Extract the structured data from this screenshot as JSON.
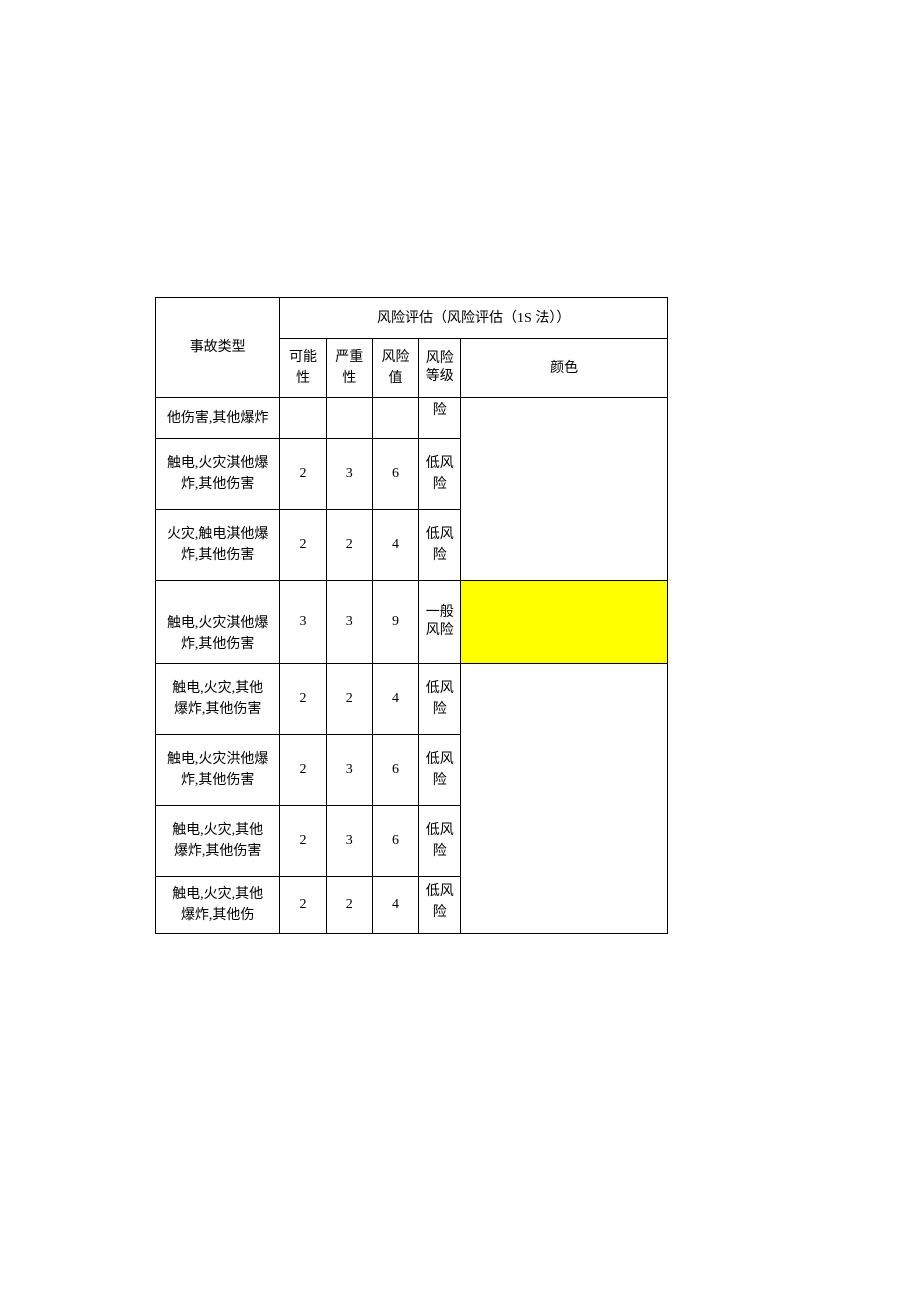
{
  "headers": {
    "accident_type": "事故类型",
    "risk_eval_group": "风险评估（风险评估（1S 法））",
    "likelihood": "可能性",
    "severity": "严重性",
    "risk_value": "风险值",
    "risk_level_l1": "风险",
    "risk_level_l2": "等级",
    "color": "颜色"
  },
  "chart_data": {
    "type": "table",
    "title": "风险评估（风险评估（1S 法））",
    "columns": [
      "事故类型",
      "可能性",
      "严重性",
      "风险值",
      "风险等级",
      "颜色"
    ],
    "color_groups": [
      {
        "rows": [
          0,
          1,
          2
        ],
        "color": ""
      },
      {
        "rows": [
          3
        ],
        "color": "#ffff00"
      },
      {
        "rows": [
          4,
          5,
          6,
          7
        ],
        "color": ""
      }
    ],
    "rows": [
      {
        "accident": "他伤害,其他爆炸",
        "likelihood": "",
        "severity": "",
        "value": "",
        "level": "险"
      },
      {
        "accident": "触电,火灾淇他爆炸,其他伤害",
        "likelihood": 2,
        "severity": 3,
        "value": 6,
        "level": "低风险"
      },
      {
        "accident": "火灾,触电淇他爆炸,其他伤害",
        "likelihood": 2,
        "severity": 2,
        "value": 4,
        "level": "低风险"
      },
      {
        "accident": "触电,火灾淇他爆炸,其他伤害",
        "likelihood": 3,
        "severity": 3,
        "value": 9,
        "level": "一般风险"
      },
      {
        "accident": "触电,火灾,其他爆炸,其他伤害",
        "likelihood": 2,
        "severity": 2,
        "value": 4,
        "level": "低风险"
      },
      {
        "accident": "触电,火灾洪他爆炸,其他伤害",
        "likelihood": 2,
        "severity": 3,
        "value": 6,
        "level": "低风险"
      },
      {
        "accident": "触电,火灾,其他爆炸,其他伤害",
        "likelihood": 2,
        "severity": 3,
        "value": 6,
        "level": "低风险"
      },
      {
        "accident": "触电,火灾,其他爆炸,其他伤",
        "likelihood": 2,
        "severity": 2,
        "value": 4,
        "level": "低风险"
      }
    ]
  },
  "rows": {
    "r0": {
      "acc_l1": "他伤害,其他爆炸",
      "acc_l2": "",
      "like": "",
      "sev": "",
      "val": "",
      "lvl": "险"
    },
    "r1": {
      "acc_l1": "触电,火灾淇他爆",
      "acc_l2": "炸,其他伤害",
      "like": "2",
      "sev": "3",
      "val": "6",
      "lvl": "低风险"
    },
    "r2": {
      "acc_l1": "火灾,触电淇他爆",
      "acc_l2": "炸,其他伤害",
      "like": "2",
      "sev": "2",
      "val": "4",
      "lvl": "低风险"
    },
    "r3": {
      "acc_l1": "触电,火灾淇他爆",
      "acc_l2": "炸,其他伤害",
      "like": "3",
      "sev": "3",
      "val": "9",
      "lvl_l1": "一般",
      "lvl_l2": "风险"
    },
    "r4": {
      "acc_l1": "触电,火灾,其他",
      "acc_l2": "爆炸,其他伤害",
      "like": "2",
      "sev": "2",
      "val": "4",
      "lvl": "低风险"
    },
    "r5": {
      "acc_l1": "触电,火灾洪他爆",
      "acc_l2": "炸,其他伤害",
      "like": "2",
      "sev": "3",
      "val": "6",
      "lvl": "低风险"
    },
    "r6": {
      "acc_l1": "触电,火灾,其他",
      "acc_l2": "爆炸,其他伤害",
      "like": "2",
      "sev": "3",
      "val": "6",
      "lvl": "低风险"
    },
    "r7": {
      "acc_l1": "触电,火灾,其他",
      "acc_l2": "爆炸,其他伤",
      "like": "2",
      "sev": "2",
      "val": "4",
      "lvl": "低风险"
    }
  }
}
